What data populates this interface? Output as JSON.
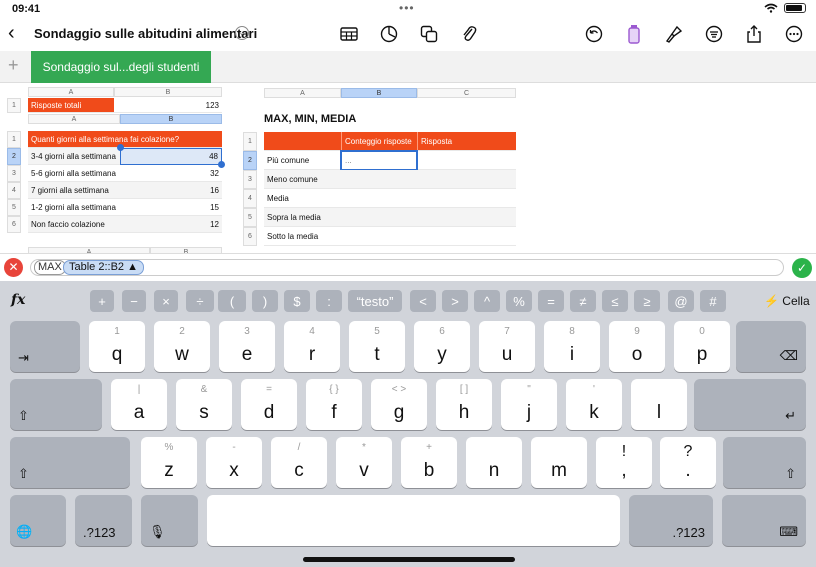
{
  "status": {
    "time": "09:41"
  },
  "toolbar": {
    "title": "Sondaggio sulle abitudini alimentari"
  },
  "sheet_tab": {
    "label": "Sondaggio sul...degli studenti"
  },
  "table1": {
    "col_a": "A",
    "col_b": "B",
    "row": "1",
    "label": "Risposte totali",
    "value": "123"
  },
  "table2": {
    "col_a": "A",
    "col_b": "B",
    "header": "Quanti giorni alla settimana fai colazione?",
    "rows": [
      {
        "num": "1",
        "label": "",
        "value": ""
      },
      {
        "num": "2",
        "label": "3-4 giorni alla settimana",
        "value": "48"
      },
      {
        "num": "3",
        "label": "5-6 giorni alla settimana",
        "value": "32"
      },
      {
        "num": "4",
        "label": "7 giorni alla settimana",
        "value": "16"
      },
      {
        "num": "5",
        "label": "1-2 giorni alla settimana",
        "value": "15"
      },
      {
        "num": "6",
        "label": "Non faccio colazione",
        "value": "12"
      }
    ],
    "next_col_a": "A",
    "next_col_b": "B"
  },
  "table3": {
    "col_a": "A",
    "col_b": "B",
    "col_c": "C",
    "title": "MAX, MIN, MEDIA",
    "head_b": "Conteggio risposte",
    "head_c": "Risposta",
    "selected_value": "...",
    "rows": [
      {
        "num": "1"
      },
      {
        "num": "2",
        "label": "Più comune"
      },
      {
        "num": "3",
        "label": "Meno comune"
      },
      {
        "num": "4",
        "label": "Media"
      },
      {
        "num": "5",
        "label": "Sopra la media"
      },
      {
        "num": "6",
        "label": "Sotto la media"
      }
    ]
  },
  "formula": {
    "func": "MAX",
    "ref": "Table 2::B2 ▲"
  },
  "fx_row": {
    "fx": "fx",
    "keys": [
      "+",
      "−",
      "×",
      "÷",
      "(",
      ")",
      "$",
      ":",
      "“testo”",
      "<",
      ">",
      "^",
      "%",
      "=",
      "≠",
      "≤",
      "≥",
      "@",
      "#"
    ],
    "cell": "Cella"
  },
  "keyboard": {
    "row1": [
      {
        "alt": "1",
        "main": "q"
      },
      {
        "alt": "2",
        "main": "w"
      },
      {
        "alt": "3",
        "main": "e"
      },
      {
        "alt": "4",
        "main": "r"
      },
      {
        "alt": "5",
        "main": "t"
      },
      {
        "alt": "6",
        "main": "y"
      },
      {
        "alt": "7",
        "main": "u"
      },
      {
        "alt": "8",
        "main": "i"
      },
      {
        "alt": "9",
        "main": "o"
      },
      {
        "alt": "0",
        "main": "p"
      }
    ],
    "row2": [
      {
        "alt": "|",
        "main": "a"
      },
      {
        "alt": "&",
        "main": "s"
      },
      {
        "alt": "=",
        "main": "d"
      },
      {
        "alt": "{ }",
        "main": "f"
      },
      {
        "alt": "< >",
        "main": "g"
      },
      {
        "alt": "[ ]",
        "main": "h"
      },
      {
        "alt": "\"",
        "main": "j"
      },
      {
        "alt": "'",
        "main": "k"
      },
      {
        "alt": "",
        "main": "l"
      }
    ],
    "row3": [
      {
        "alt": "%",
        "main": "z"
      },
      {
        "alt": "-",
        "main": "x"
      },
      {
        "alt": "/",
        "main": "c"
      },
      {
        "alt": "*",
        "main": "v"
      },
      {
        "alt": "+",
        "main": "b"
      },
      {
        "alt": "",
        "main": "n"
      },
      {
        "alt": "",
        "main": "m"
      }
    ],
    "punct": [
      {
        "alt": "!",
        "main": ","
      },
      {
        "alt": "?",
        "main": "."
      }
    ],
    "num_label": ".?123"
  }
}
